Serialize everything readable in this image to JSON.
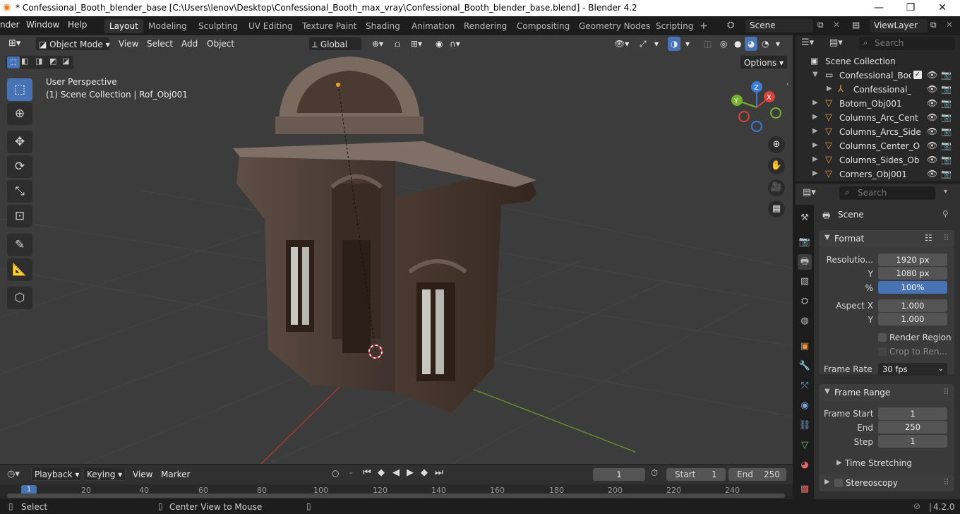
{
  "window": {
    "title": "* Confessional_Booth_blender_base [C:\\Users\\lenov\\Desktop\\Confessional_Booth_max_vray\\Confessional_Booth_blender_base.blend] - Blender 4.2",
    "minimize": "—",
    "maximize": "❐",
    "close": "✕"
  },
  "menu": {
    "items": [
      "nder",
      "Window",
      "Help"
    ],
    "workspaces": [
      "Layout",
      "Modeling",
      "Sculpting",
      "UV Editing",
      "Texture Paint",
      "Shading",
      "Animation",
      "Rendering",
      "Compositing",
      "Geometry Nodes",
      "Scripting"
    ],
    "active_workspace": "Layout",
    "add_tab": "+",
    "scene": "Scene",
    "view_layer": "ViewLayer"
  },
  "viewport": {
    "mode": "Object Mode",
    "menus": [
      "View",
      "Select",
      "Add",
      "Object"
    ],
    "orientation": "Global",
    "options": "Options",
    "overlay_title": "User Perspective",
    "overlay_subtitle": "(1) Scene Collection | Rof_Obj001",
    "gizmo_axes": [
      "X",
      "Y",
      "Z"
    ],
    "colors": {
      "background": "#3c3c3c",
      "grid": "#444444",
      "x_axis": "#a33a3a",
      "y_axis": "#6a8a2a",
      "active": "#4772b3"
    }
  },
  "tools": [
    "select-box-icon",
    "cursor-icon",
    "move-icon",
    "rotate-icon",
    "scale-icon",
    "transform-icon",
    "annotate-icon",
    "measure-icon",
    "add-cube-icon"
  ],
  "outliner": {
    "search_placeholder": "Search",
    "root": "Scene Collection",
    "rows": [
      {
        "name": "Confessional_Boot",
        "level": 1
      },
      {
        "name": "Confessional_E",
        "level": 2
      },
      {
        "name": "Botom_Obj001",
        "level": 1
      },
      {
        "name": "Columns_Arc_Cent",
        "level": 1
      },
      {
        "name": "Columns_Arcs_Side",
        "level": 1
      },
      {
        "name": "Columns_Center_O",
        "level": 1
      },
      {
        "name": "Columns_Sides_Ob",
        "level": 1
      },
      {
        "name": "Corners_Obj001",
        "level": 1
      }
    ]
  },
  "properties": {
    "search_placeholder": "Search",
    "context": "Scene",
    "format": {
      "header": "Format",
      "resolution_label": "Resolutio...",
      "res_x": "1920 px",
      "y_label": "Y",
      "res_y": "1080 px",
      "pct_label": "%",
      "res_pct": "100%",
      "aspect_x_label": "Aspect X",
      "aspect_x": "1.000",
      "aspect_y_label": "Y",
      "aspect_y": "1.000",
      "render_region": "Render Region",
      "crop": "Crop to Ren...",
      "frame_rate_label": "Frame Rate",
      "frame_rate": "30 fps"
    },
    "frame_range": {
      "header": "Frame Range",
      "start_label": "Frame Start",
      "start": "1",
      "end_label": "End",
      "end": "250",
      "step_label": "Step",
      "step": "1",
      "time_stretching": "Time Stretching"
    },
    "stereoscopy": "Stereoscopy"
  },
  "timeline": {
    "menus": [
      "Playback",
      "Keying",
      "View",
      "Marker"
    ],
    "current_frame": "1",
    "start_label": "Start",
    "start": "1",
    "end_label": "End",
    "end": "250",
    "ticks": [
      "1",
      "20",
      "40",
      "60",
      "80",
      "100",
      "120",
      "140",
      "160",
      "180",
      "200",
      "220",
      "240"
    ]
  },
  "statusbar": {
    "left": "Select",
    "middle": "Center View to Mouse",
    "version": "4.2.0"
  }
}
